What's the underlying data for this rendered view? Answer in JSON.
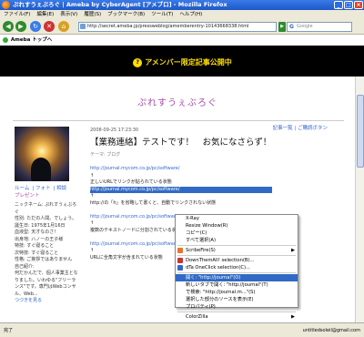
{
  "window": {
    "title": "ぷれすうぇぶろぐ | Ameba by CyberAgent [アメブロ] - Mozilla Firefox"
  },
  "menubar": [
    "ファイル(F)",
    "編集(E)",
    "表示(V)",
    "履歴(S)",
    "ブックマーク(B)",
    "ツール(T)",
    "ヘルプ(H)"
  ],
  "toolbar": {
    "url": "http://secret.ameba.jp/pressweblog/amemberentry-10143668338.html",
    "search_placeholder": "Google"
  },
  "ameba_nav": {
    "home": "Ameba トップへ"
  },
  "banner": {
    "text": "アメンバー限定記事公開中"
  },
  "blog": {
    "title": "ぷれすうぇぶろぐ",
    "top_links": "記事一覧 | ご購読ボタン"
  },
  "sidebar": {
    "links": [
      "ルーム",
      "フォト",
      "相談"
    ],
    "present": "プレゼント",
    "profile": [
      "ニックネーム: ぷれすうぇぶろぐ",
      "性別: ただの人間。でしょう。",
      "誕生日: 1975年1月16日",
      "血液型: 天才なのさ！",
      "出身地: ハノーの王子様",
      "特技: すぐ寝ること",
      "次特技: すぐ寝ること",
      "性格: ご挨拶ではありません",
      "自己紹介:",
      "何だかんだで、個人事業主となりました。いわゆる\"フリーランス\"です。専門はWebコンサル、Web...",
      "つづきを見る"
    ]
  },
  "post": {
    "date": "2008-09-25 17:23:30",
    "title": "【業務連絡】テストです！　お気になさらず！",
    "theme": "テーマ: ブログ",
    "body": [
      "http://journal.mycom.co.jp/pc/software/",
      "↑",
      "正しいURLでリンクが貼られている状態",
      "",
      "http://journal.mycom.co.jp/pc/software/",
      "↑",
      "http://の「h」を省略して書くと、自動でリンクされない状態",
      "",
      "http://journal.mycom.co.jp/pc/software/",
      "↑",
      "複数のテキストノードに分割されている状態",
      "",
      "http://journal.mycom.co.jp/pc/software/",
      "↑",
      "URLに全角文字が含まれている状態"
    ]
  },
  "context_menu": [
    {
      "label": "X-Ray"
    },
    {
      "label": "Resize Window(R)"
    },
    {
      "label": "コピー(C)"
    },
    {
      "label": "すべて選択(A)"
    },
    {
      "sep": true
    },
    {
      "label": "ScribeFire(S)",
      "submenu": true,
      "icon": "scribefire-icon"
    },
    {
      "sep": true
    },
    {
      "label": "DownThemAll! selection(B)...",
      "icon": "downthemall-icon"
    },
    {
      "label": "dTa OneClick selection(C)...",
      "icon": "dta-icon"
    },
    {
      "sep": true
    },
    {
      "label": "開く: \"http://journal\"(O)",
      "highlighted": true
    },
    {
      "label": "新しいタブで開く: \"http://journal\"(T)"
    },
    {
      "label": "で検索: \"http://journal.m...\"(S)"
    },
    {
      "label": "選択した部分のソースを表示(E)"
    },
    {
      "label": "プロパティ(P)"
    },
    {
      "sep": true
    },
    {
      "label": "ColorZilla",
      "submenu": true
    }
  ],
  "statusbar": {
    "left": "完了",
    "right": "untitledsoleil@gmail.com"
  }
}
